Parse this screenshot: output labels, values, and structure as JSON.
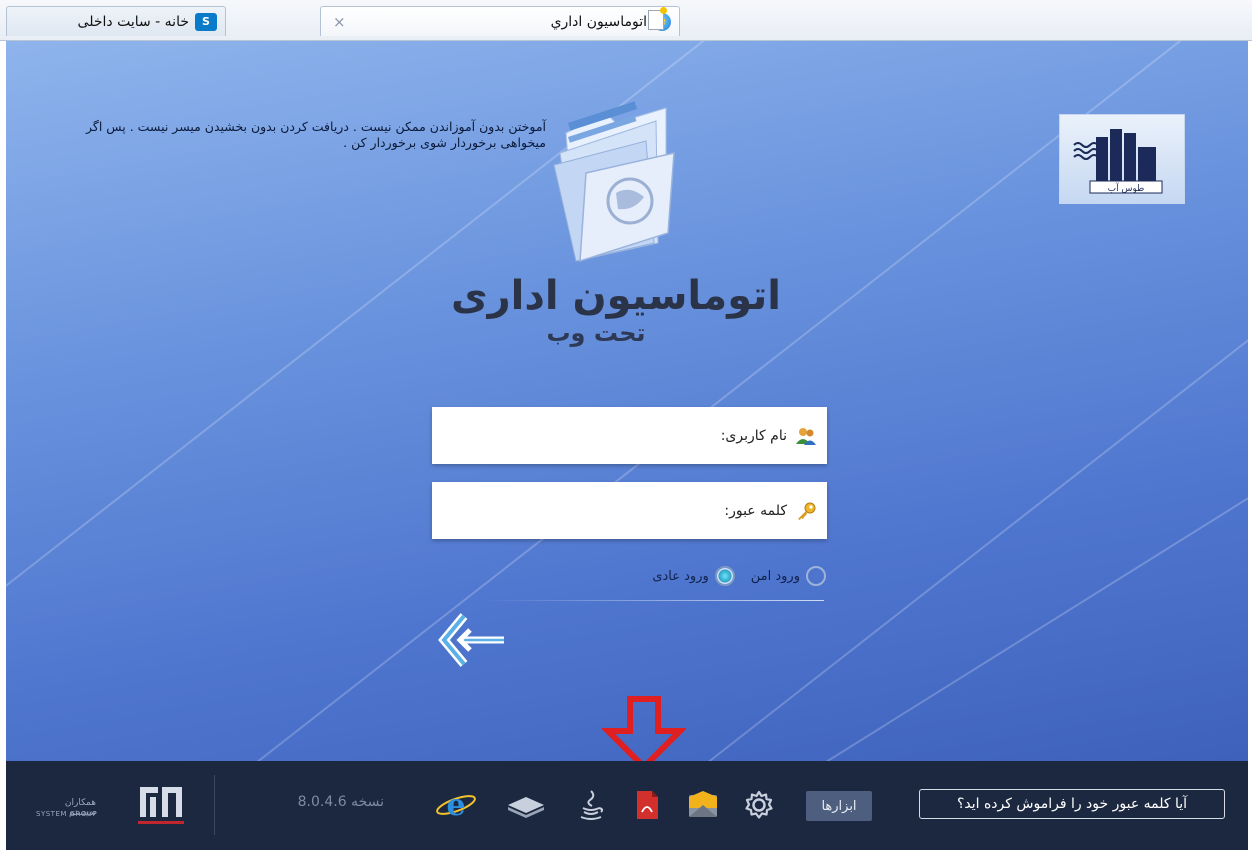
{
  "browser": {
    "tabs": [
      {
        "label": "اتوماسیون اداري",
        "active": true,
        "icon": "ie-icon"
      },
      {
        "label": "خانه - سایت داخلی",
        "active": false,
        "icon": "sharepoint-icon"
      }
    ],
    "close_glyph": "×"
  },
  "branding": {
    "quote": "آموختن بدون آموزاندن ممکن نیست . دریافت کردن بدون بخشیدن میسر نیست . پس اگر میخواهی برخوردار شوی برخوردار کن .",
    "app_title": "اتوماسیون اداری",
    "app_subtitle": "تحت وب",
    "company_logo_text": "طوس آب"
  },
  "login": {
    "username_label": "نام کاربری:",
    "username_value": "",
    "password_label": "کلمه عبور:",
    "password_value": "",
    "secure_login_label": "ورود امن",
    "normal_login_label": "ورود عادی",
    "selected_mode": "normal"
  },
  "footer": {
    "forgot_password_label": "آیا کلمه عبور خود را فراموش کرده اید؟",
    "tools_label": "ابزارها",
    "tool_icons": [
      "settings-icon",
      "mail-icon",
      "pdf-icon",
      "java-icon",
      "book-icon",
      "ie-icon"
    ],
    "version": "نسخه 8.0.4.6",
    "vendor_name": "همکاران سیستم",
    "vendor_name_en": "SYSTEM GROUP"
  },
  "colors": {
    "bottombar": "#1c2840",
    "panel": "#5f87d8",
    "annotation_arrow": "#e02020"
  }
}
